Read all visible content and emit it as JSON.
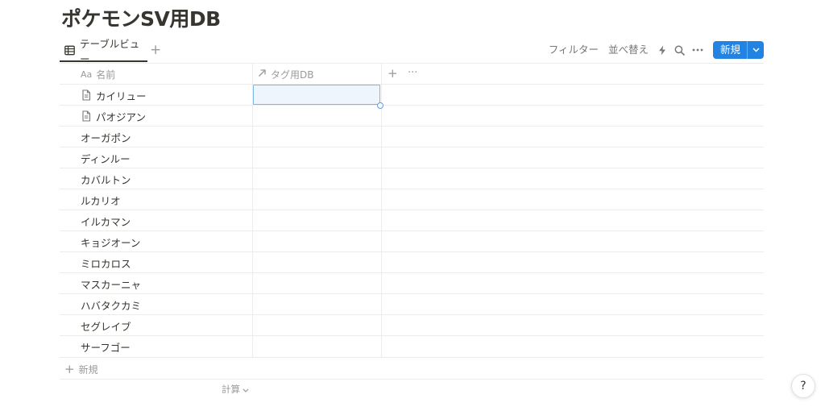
{
  "page": {
    "title": "ポケモンSV用DB"
  },
  "views": {
    "active_tab": "テーブルビュー",
    "add": "+"
  },
  "toolbar": {
    "filter": "フィルター",
    "sort": "並べ替え",
    "new_label": "新規",
    "icons": [
      "lightning-icon",
      "search-icon",
      "more-icon",
      "chevron-down-icon"
    ]
  },
  "table": {
    "columns": [
      {
        "icon": "Aa",
        "label": "名前"
      },
      {
        "icon": "relation-arrow-icon",
        "label": "タグ用DB"
      }
    ],
    "add_column": "+",
    "more": "···",
    "rows": [
      {
        "name": "カイリュー",
        "has_doc_icon": true
      },
      {
        "name": "パオジアン",
        "has_doc_icon": true
      },
      {
        "name": "オーガポン",
        "has_doc_icon": false
      },
      {
        "name": "ディンルー",
        "has_doc_icon": false
      },
      {
        "name": "カバルトン",
        "has_doc_icon": false
      },
      {
        "name": "ルカリオ",
        "has_doc_icon": false
      },
      {
        "name": "イルカマン",
        "has_doc_icon": false
      },
      {
        "name": "キョジオーン",
        "has_doc_icon": false
      },
      {
        "name": "ミロカロス",
        "has_doc_icon": false
      },
      {
        "name": "マスカーニャ",
        "has_doc_icon": false
      },
      {
        "name": "ハバタクカミ",
        "has_doc_icon": false
      },
      {
        "name": "セグレイブ",
        "has_doc_icon": false
      },
      {
        "name": "サーフゴー",
        "has_doc_icon": false
      }
    ],
    "add_row": "新規",
    "calculate": "計算"
  },
  "help": {
    "label": "?"
  },
  "colors": {
    "accent": "#2383e2",
    "border": "#ececeb",
    "muted": "#9b9a97",
    "text": "#37352f"
  }
}
